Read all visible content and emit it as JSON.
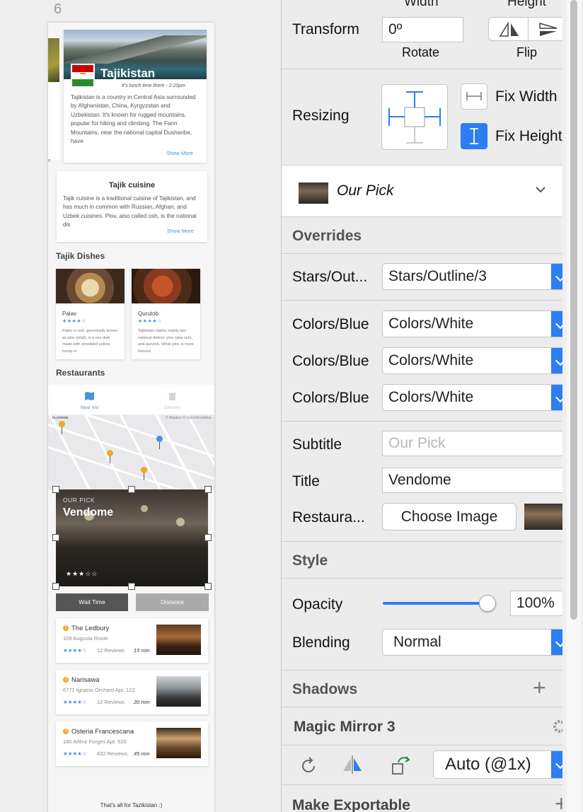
{
  "artboard": {
    "number": "6",
    "prev_more": "e",
    "country": {
      "title": "Tajikistan",
      "lunch": "It's lunch time there - 2:20pm",
      "text": "Tajikistan is a country in Central Asia surrounded by Afghanistan, China, Kyrgyzstan and Uzbekistan. It's known for rugged mountains, popular for hiking and climbing. The Fann Mountains, near the national capital Dushanbe, have",
      "show_more": "Show More"
    },
    "cuisine": {
      "title": "Tajik cuisine",
      "text": "Tajik cuisine is a traditional cuisine of Tajikistan, and has much in common with Russian, Afghan, and Uzbek cuisines. Plov, also called osh, is the national dis",
      "show_more": "Show More"
    },
    "dishes_heading": "Tajik Dishes",
    "dishes": [
      {
        "name": "Palav",
        "stars": "★★★★☆",
        "text": "Palav or osh, generically known as plov (pilaf), is a rice dish made with shredded yellow turnip or"
      },
      {
        "name": "Qurutob",
        "stars": "★★★★☆",
        "text": "Tajikistan claims mainly two national dishes: plov (aka osh), and qurutob. While plov is more famous"
      }
    ],
    "restaurants_heading": "Restaurants",
    "tabs": [
      "Near me",
      "Dilevery"
    ],
    "map": {
      "credit": "© Mapbox © OpenStreetMap",
      "district": "FLATIRON"
    },
    "pick": {
      "subtitle": "OUR PICK",
      "title": "Vendome",
      "stars": "★★★☆☆"
    },
    "sort_buttons": [
      "Wait Time",
      "Distance"
    ],
    "restaurants": [
      {
        "num": "1",
        "name": "The Ledbury",
        "address": "109 Augusta Route",
        "stars": "★★★★☆",
        "reviews": "12 Reviews",
        "time": "15 min"
      },
      {
        "num": "2",
        "name": "Narisawa",
        "address": "6771 Ignacio Orchard Apt. 122",
        "stars": "★★★★☆",
        "reviews": "12 Reviews",
        "time": "20 min"
      },
      {
        "num": "3",
        "name": "Osteria Francescana",
        "address": "180 Arthur Forges Apt. 520",
        "stars": "★★★★☆",
        "reviews": "432 Reviews",
        "time": "45 min"
      }
    ],
    "footer": "That's all for Tazikistan :)"
  },
  "inspector": {
    "transform": {
      "width_label": "Width",
      "height_label": "Height",
      "label": "Transform",
      "rotate_value": "0º",
      "rotate_label": "Rotate",
      "flip_label": "Flip"
    },
    "resizing": {
      "label": "Resizing",
      "fix_width": "Fix Width",
      "fix_height": "Fix Height"
    },
    "symbol": {
      "name": "Our Pick"
    },
    "overrides": {
      "heading": "Overrides",
      "stars_label": "Stars/Out...",
      "stars_value": "Stars/Outline/3",
      "colors": [
        {
          "label": "Colors/Blue",
          "value": "Colors/White"
        },
        {
          "label": "Colors/Blue",
          "value": "Colors/White"
        },
        {
          "label": "Colors/Blue",
          "value": "Colors/White"
        }
      ],
      "subtitle_label": "Subtitle",
      "subtitle_placeholder": "Our Pick",
      "title_label": "Title",
      "title_value": "Vendome",
      "restaurant_label": "Restaura...",
      "choose_image": "Choose Image"
    },
    "style": {
      "heading": "Style",
      "opacity_label": "Opacity",
      "opacity_value": "100%",
      "opacity_level": 1.0,
      "blending_label": "Blending",
      "blending_value": "Normal"
    },
    "shadows": {
      "heading": "Shadows",
      "add": "+"
    },
    "magic_mirror": {
      "heading": "Magic Mirror 3",
      "scale": "Auto (@1x)"
    },
    "exportable": {
      "heading": "Make Exportable",
      "add": "+"
    }
  },
  "colors": {
    "accent": "#2d7ef2",
    "link": "#4a90e2",
    "star": "#f5a623"
  }
}
